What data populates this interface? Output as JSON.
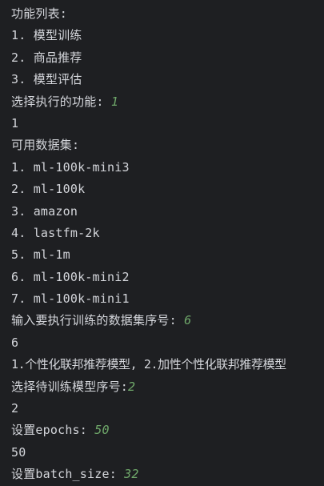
{
  "console": {
    "lines": [
      {
        "text": "功能列表:"
      },
      {
        "text": "1. 模型训练"
      },
      {
        "text": "2. 商品推荐"
      },
      {
        "text": "3. 模型评估"
      },
      {
        "prompt": "选择执行的功能: ",
        "input": "1"
      },
      {
        "text": "1"
      },
      {
        "text": "可用数据集:"
      },
      {
        "text": "1. ml-100k-mini3"
      },
      {
        "text": "2. ml-100k"
      },
      {
        "text": "3. amazon"
      },
      {
        "text": "4. lastfm-2k"
      },
      {
        "text": "5. ml-1m"
      },
      {
        "text": "6. ml-100k-mini2"
      },
      {
        "text": "7. ml-100k-mini1"
      },
      {
        "prompt": "输入要执行训练的数据集序号: ",
        "input": "6"
      },
      {
        "text": "6"
      },
      {
        "text": "1.个性化联邦推荐模型, 2.加性个性化联邦推荐模型"
      },
      {
        "prompt": "选择待训练模型序号:",
        "input": "2"
      },
      {
        "text": "2"
      },
      {
        "prompt": "设置epochs: ",
        "input": "50"
      },
      {
        "text": "50"
      },
      {
        "prompt": "设置batch_size: ",
        "input": "32"
      }
    ],
    "colors": {
      "background": "#1e1f22",
      "text": "#d4d6db",
      "user_input": "#6fa86a"
    }
  }
}
